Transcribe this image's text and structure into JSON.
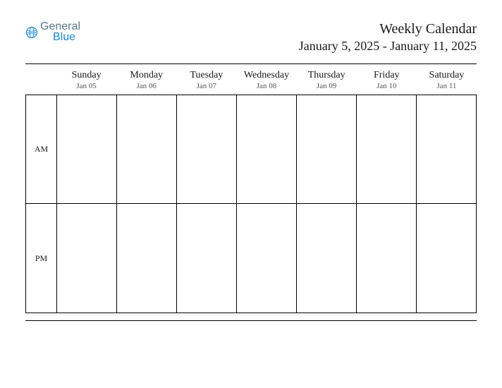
{
  "logo": {
    "word1": "General",
    "word2": "Blue"
  },
  "title": "Weekly Calendar",
  "date_range": "January 5, 2025 - January 11, 2025",
  "time_labels": {
    "am": "AM",
    "pm": "PM"
  },
  "days": [
    {
      "name": "Sunday",
      "date": "Jan 05"
    },
    {
      "name": "Monday",
      "date": "Jan 06"
    },
    {
      "name": "Tuesday",
      "date": "Jan 07"
    },
    {
      "name": "Wednesday",
      "date": "Jan 08"
    },
    {
      "name": "Thursday",
      "date": "Jan 09"
    },
    {
      "name": "Friday",
      "date": "Jan 10"
    },
    {
      "name": "Saturday",
      "date": "Jan 11"
    }
  ]
}
